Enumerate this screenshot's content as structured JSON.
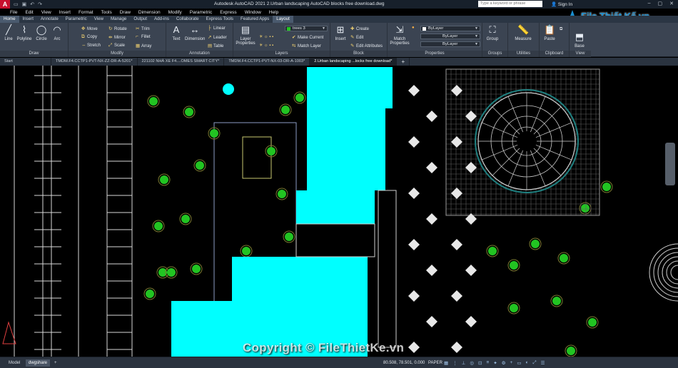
{
  "titlebar": {
    "app_letter": "A",
    "title": "Autodesk AutoCAD 2021   2.Urban landscaping AutoCAD blocks free download.dwg",
    "search_placeholder": "Type a keyword or phrase",
    "signin": "Sign In",
    "qat_icons": [
      "open-icon",
      "save-icon",
      "undo-icon",
      "redo-icon"
    ]
  },
  "menubar": [
    "File",
    "Edit",
    "View",
    "Insert",
    "Format",
    "Tools",
    "Draw",
    "Dimension",
    "Modify",
    "Parametric",
    "Express",
    "Window",
    "Help"
  ],
  "ribbon_tabs": [
    "Home",
    "Insert",
    "Annotate",
    "Parametric",
    "View",
    "Manage",
    "Output",
    "Add-ins",
    "Collaborate",
    "Express Tools",
    "Featured Apps",
    "Layout"
  ],
  "ribbon_tabs_active": [
    "Home",
    "Layout"
  ],
  "ribbon": {
    "draw": {
      "label": "Draw",
      "tools": [
        "Line",
        "Polyline",
        "Circle",
        "Arc"
      ]
    },
    "modify": {
      "label": "Modify",
      "tools": [
        "Move",
        "Copy",
        "Stretch",
        "Rotate",
        "Mirror",
        "Scale",
        "Trim",
        "Fillet",
        "Array"
      ]
    },
    "annotation": {
      "label": "Annotation",
      "tools": [
        "Text",
        "Dimension",
        "Linear",
        "Leader",
        "Table"
      ]
    },
    "layers": {
      "label": "Layers",
      "tools": [
        "Layer Properties"
      ],
      "current_layer": "trees 3",
      "actions": [
        "Make Current",
        "Match Layer"
      ]
    },
    "block": {
      "label": "Block",
      "tools": [
        "Insert",
        "Create",
        "Edit",
        "Edit Attributes"
      ]
    },
    "properties": {
      "label": "Properties",
      "tools": [
        "Match Properties"
      ],
      "color": "ByLayer",
      "linetype": "ByLayer",
      "lineweight": "ByLayer"
    },
    "groups": {
      "label": "Groups",
      "tools": [
        "Group"
      ]
    },
    "utilities": {
      "label": "Utilities",
      "tools": [
        "Measure"
      ]
    },
    "clipboard": {
      "label": "Clipboard",
      "tools": [
        "Paste"
      ]
    },
    "view": {
      "label": "View",
      "tools": [
        "Base"
      ]
    }
  },
  "file_tabs": [
    "Start",
    "TMDM.F4.CCTP1-PVT-NX-ZZ-DR-A-5201*",
    "221102 NHÀ XE F4....OMES SMART CITY*",
    "TMDM.F4.CCTP1-PVT-NX-03-DR-A-1003*",
    "2.Urban landscaping ...locks free download*"
  ],
  "file_tab_active": 4,
  "status": {
    "layout_tabs": [
      "Model",
      "dwgshare"
    ],
    "active_layout": 1,
    "coords": "80.508, 78.501, 0.000",
    "space": "PAPER"
  },
  "watermark": {
    "text": "Copyright © FileThietKe.vn",
    "logo_text": "File Thiết Kế.vn"
  },
  "colors": {
    "accent_cyan": "#00ffff",
    "tree_green": "#22c422",
    "ribbon_bg": "#3b4452",
    "autocad_red": "#c8102e"
  }
}
